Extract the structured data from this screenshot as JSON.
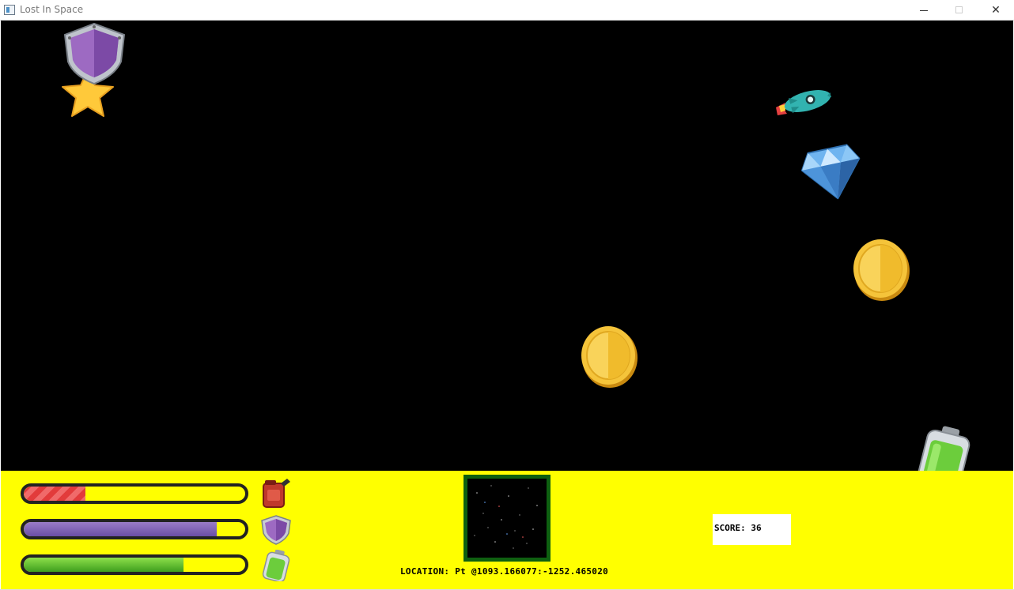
{
  "window": {
    "title": "Lost In Space",
    "min_glyph": "—",
    "close_glyph": "✕"
  },
  "colors": {
    "space_background": "#000000",
    "hud_background": "#ffff00",
    "fuel_bar": "#e23b3b",
    "shield_bar": "#7a5cb6",
    "battery_bar": "#5fc02e",
    "minimap_border": "#0e6010"
  },
  "sprites": [
    "shield-star-powerup",
    "rocket-ship",
    "blue-diamond",
    "gold-coin",
    "gold-coin",
    "battery-pickup"
  ],
  "hud": {
    "bars": [
      {
        "name": "fuel",
        "level": 0.28,
        "icon": "fuel-can-icon"
      },
      {
        "name": "shield",
        "level": 0.87,
        "icon": "shield-icon"
      },
      {
        "name": "battery",
        "level": 0.72,
        "icon": "battery-icon"
      }
    ],
    "location_text": "LOCATION: Pt @1093.166077:-1252.465020",
    "score_text": "SCORE: 36"
  }
}
